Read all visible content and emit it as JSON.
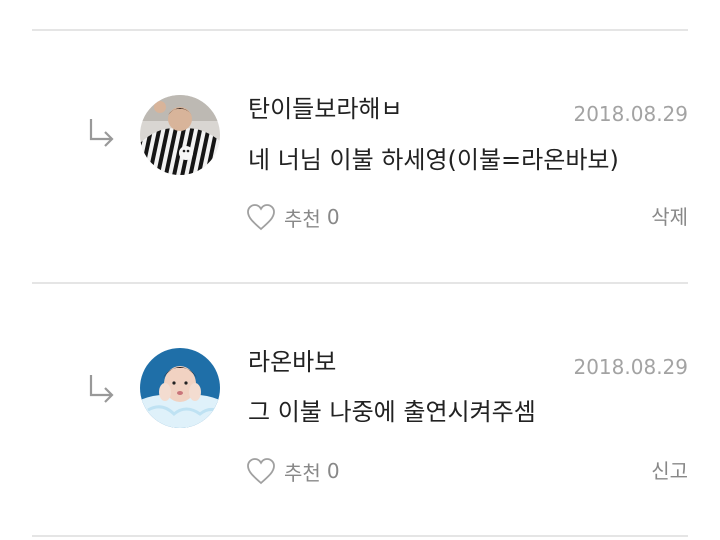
{
  "comments": [
    {
      "author": "탄이들보라해ㅂ",
      "date": "2018.08.29",
      "text": "네 너님 이불 하세영(이불=라온바보)",
      "like_label": "추천",
      "like_count": "0",
      "action_label": "삭제"
    },
    {
      "author": "라온바보",
      "date": "2018.08.29",
      "text": "그 이불 나중에 출연시켜주셈",
      "like_label": "추천",
      "like_count": "0",
      "action_label": "신고"
    }
  ],
  "icons": {
    "reply": "reply-arrow-icon",
    "like": "heart-outline-icon"
  },
  "colors": {
    "text": "#222222",
    "muted": "#888888",
    "date": "#a3a3a3",
    "divider": "#e5e5e5"
  }
}
